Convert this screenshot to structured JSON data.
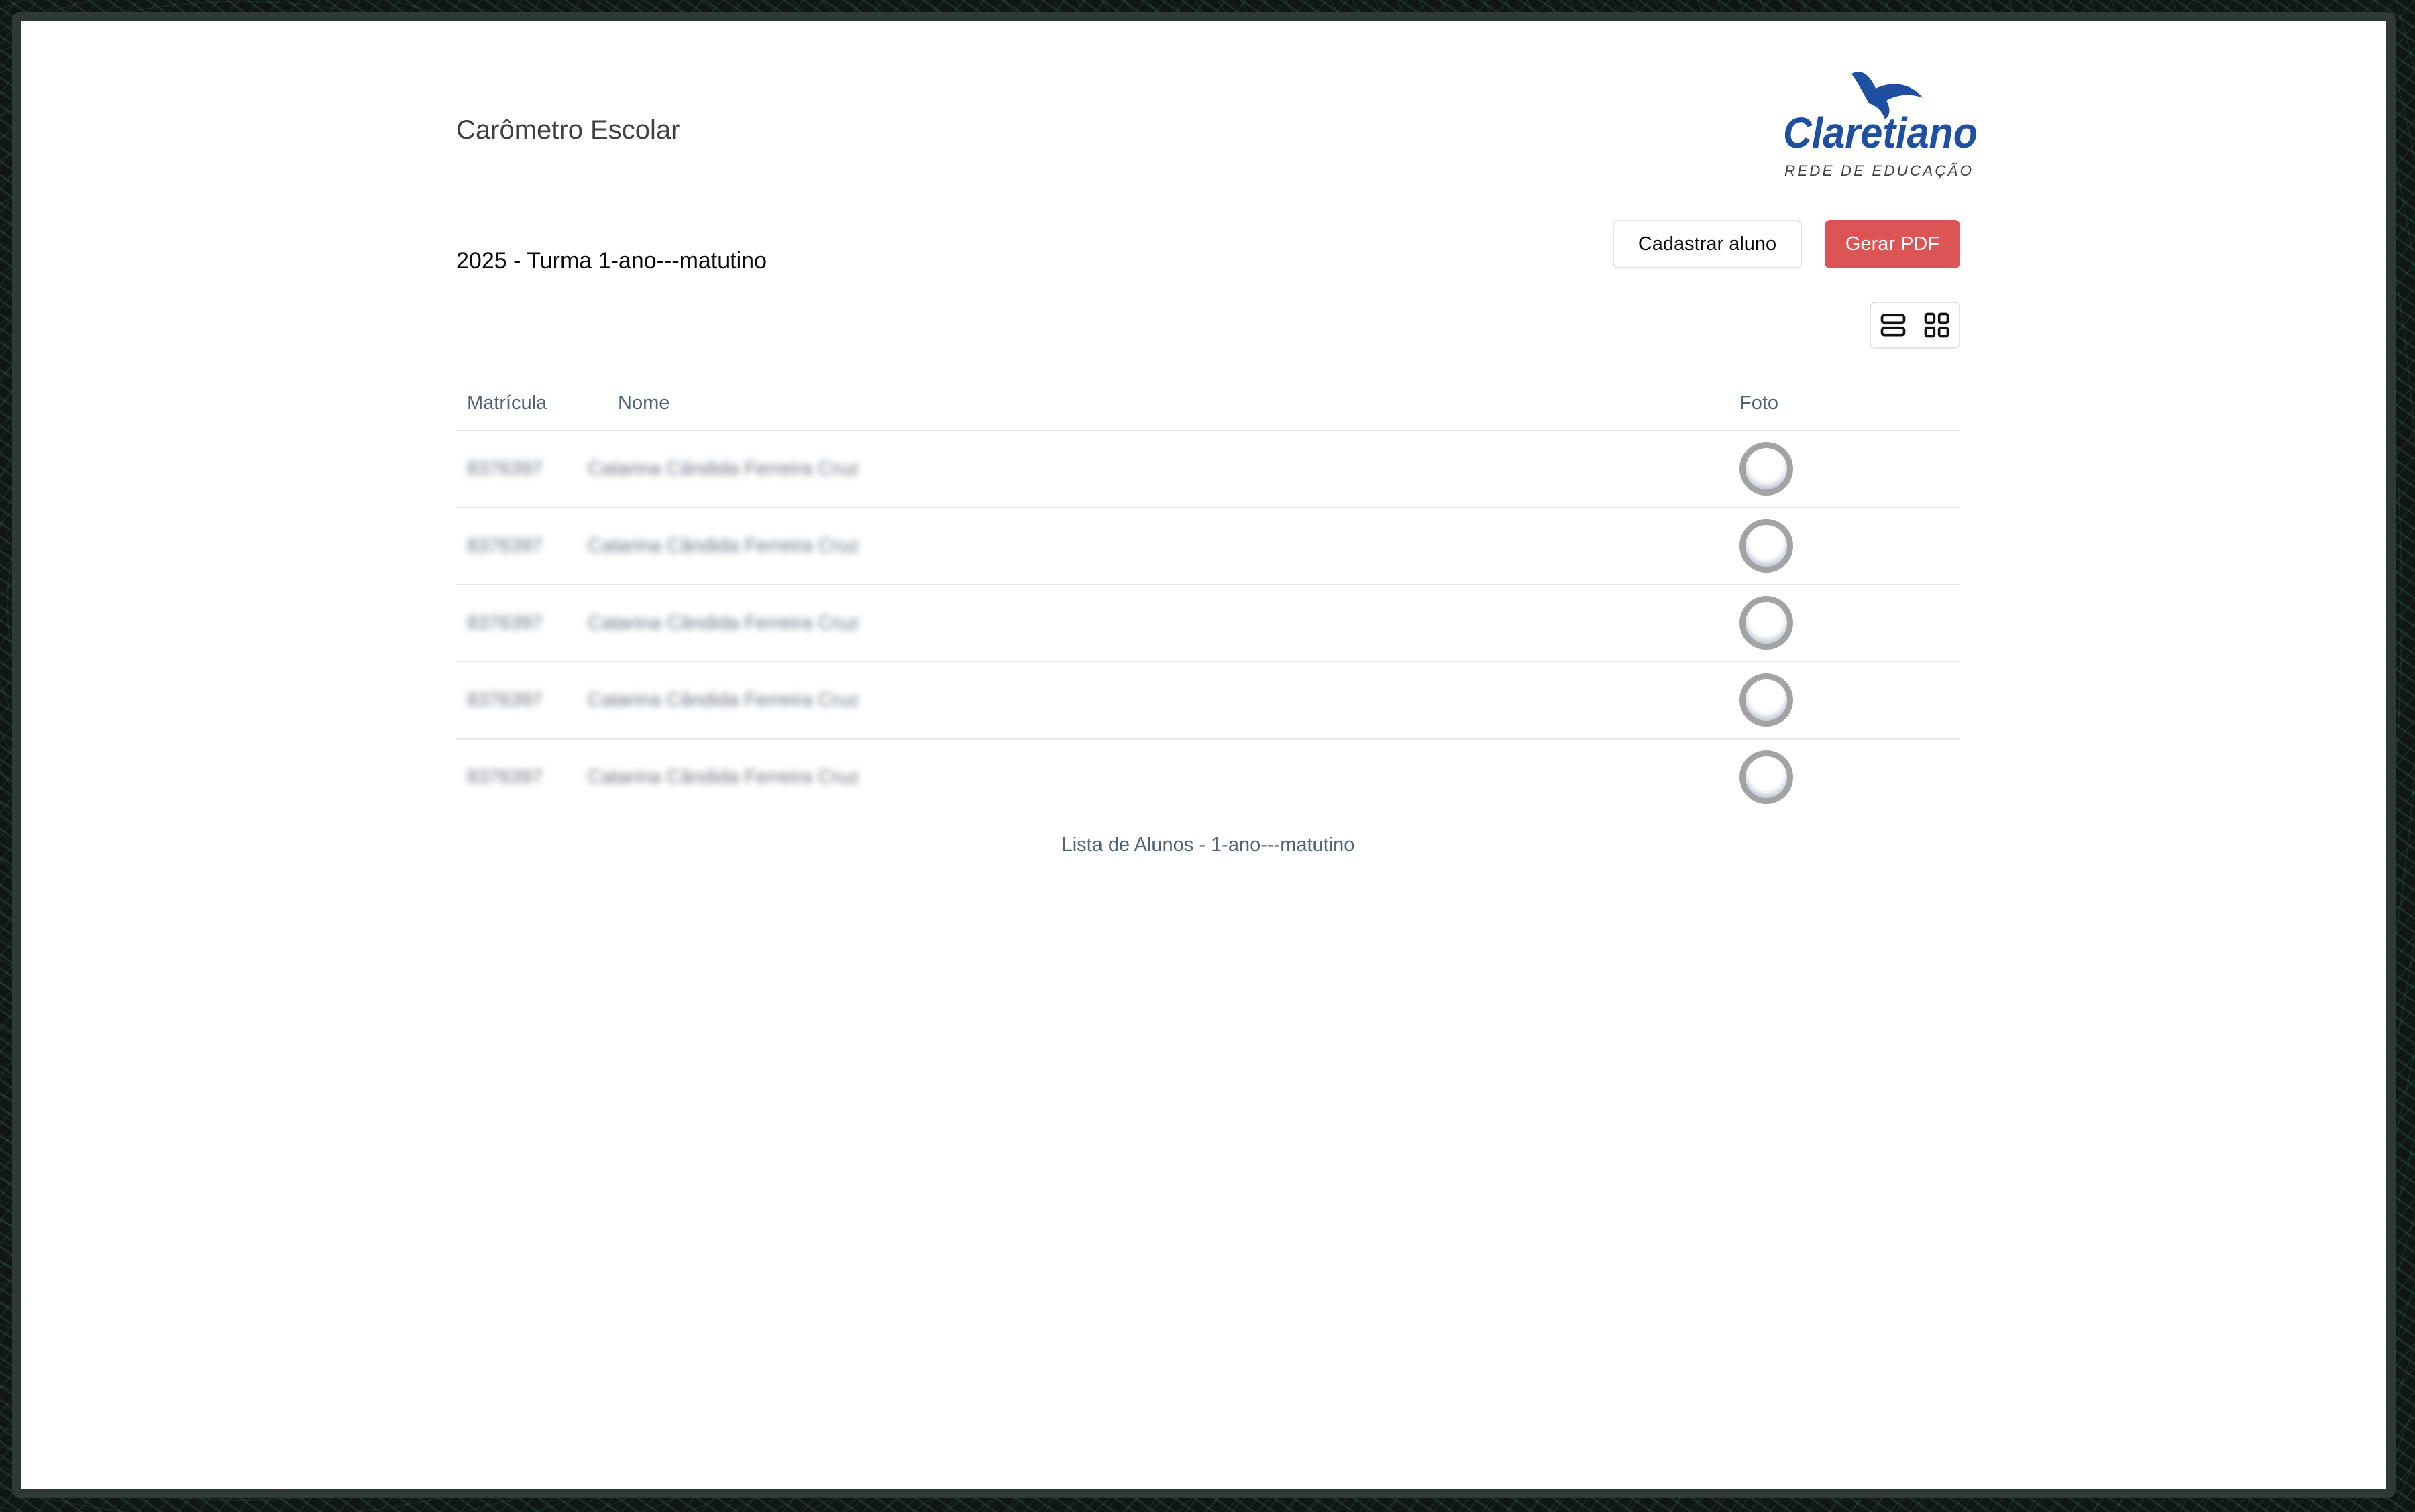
{
  "header": {
    "app_title": "Carômetro Escolar",
    "logo": {
      "wordmark": "Claretiano",
      "tagline": "REDE DE EDUCAÇÃO",
      "brand_color": "#1f4fa0"
    }
  },
  "class_title": "2025 - Turma 1-ano---matutino",
  "actions": {
    "register_label": "Cadastrar aluno",
    "pdf_label": "Gerar PDF",
    "pdf_color": "#dc5454"
  },
  "view_toggle": {
    "list_icon": "rows-icon",
    "grid_icon": "grid-icon"
  },
  "table": {
    "columns": [
      "Matrícula",
      "Nome",
      "Foto"
    ],
    "rows": [
      {
        "matricula": "8376397",
        "nome": "Catarina Cândida Ferreira Cruz"
      },
      {
        "matricula": "8376397",
        "nome": "Catarina Cândida Ferreira Cruz"
      },
      {
        "matricula": "8376397",
        "nome": "Catarina Cândida Ferreira Cruz"
      },
      {
        "matricula": "8376397",
        "nome": "Catarina Cândida Ferreira Cruz"
      },
      {
        "matricula": "8376397",
        "nome": "Catarina Cândida Ferreira Cruz"
      }
    ],
    "caption": "Lista de Alunos - 1-ano---matutino"
  }
}
